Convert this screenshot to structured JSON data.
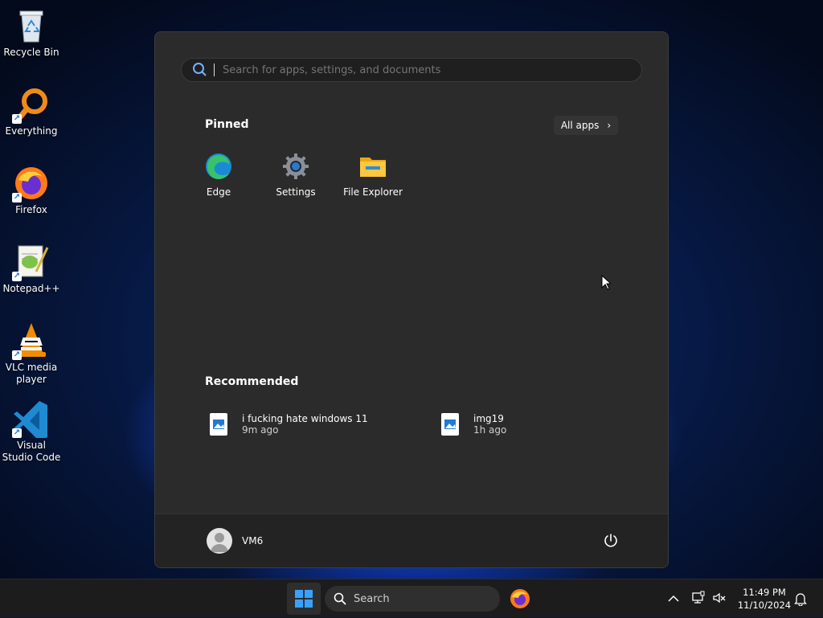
{
  "desktop": {
    "icons": [
      {
        "label": "Recycle Bin",
        "icon": "recycle-bin-icon"
      },
      {
        "label": "Everything",
        "icon": "everything-search-icon"
      },
      {
        "label": "Firefox",
        "icon": "firefox-icon"
      },
      {
        "label": "Notepad++",
        "icon": "notepad-plus-plus-icon"
      },
      {
        "label": "VLC media player",
        "icon": "vlc-icon"
      },
      {
        "label": "Visual Studio Code",
        "icon": "vscode-icon"
      }
    ]
  },
  "start_menu": {
    "search_placeholder": "Search for apps, settings, and documents",
    "pinned_title": "Pinned",
    "all_apps_label": "All apps",
    "pinned": [
      {
        "label": "Edge",
        "icon": "edge-icon"
      },
      {
        "label": "Settings",
        "icon": "settings-gear-icon"
      },
      {
        "label": "File Explorer",
        "icon": "file-explorer-icon"
      }
    ],
    "recommended_title": "Recommended",
    "recommended": [
      {
        "name": "i fucking hate windows 11",
        "time": "9m ago"
      },
      {
        "name": "img19",
        "time": "1h ago"
      }
    ],
    "user_name": "VM6"
  },
  "taskbar": {
    "search_label": "Search",
    "time": "11:49 PM",
    "date": "11/10/2024"
  },
  "colors": {
    "accent": "#0067c0",
    "menu_bg": "#2b2b2b",
    "taskbar_bg": "#1c1c1c"
  }
}
